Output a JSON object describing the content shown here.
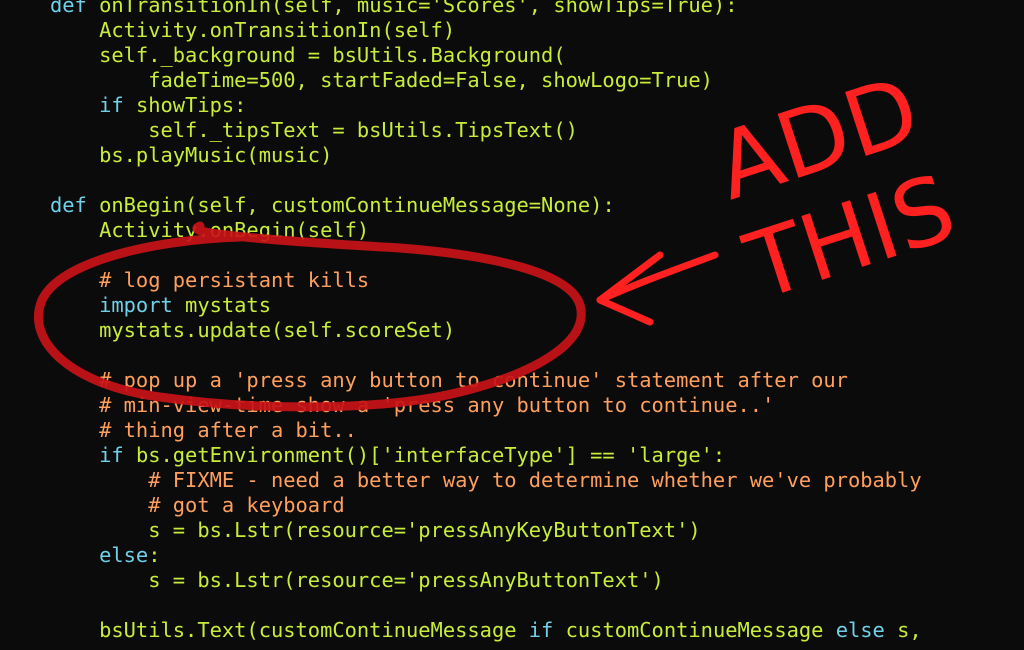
{
  "code_lines": [
    {
      "segments": [
        {
          "t": "def ",
          "c": "def"
        },
        {
          "t": "onTransitionIn",
          "c": "fn"
        },
        {
          "t": "(self, music='Scores', showTips=True):",
          "c": "txt"
        }
      ]
    },
    {
      "segments": [
        {
          "t": "    Activity.onTransitionIn(self)",
          "c": "txt"
        }
      ]
    },
    {
      "segments": [
        {
          "t": "    self._background = bsUtils.Background(",
          "c": "txt"
        }
      ]
    },
    {
      "segments": [
        {
          "t": "        fadeTime=500, startFaded=False, showLogo=True)",
          "c": "txt"
        }
      ]
    },
    {
      "segments": [
        {
          "t": "    if ",
          "c": "kw"
        },
        {
          "t": "showTips:",
          "c": "txt"
        }
      ]
    },
    {
      "segments": [
        {
          "t": "        self._tipsText = bsUtils.TipsText()",
          "c": "txt"
        }
      ]
    },
    {
      "segments": [
        {
          "t": "    bs.playMusic(music)",
          "c": "txt"
        }
      ]
    },
    {
      "segments": [
        {
          "t": "",
          "c": "txt"
        }
      ]
    },
    {
      "segments": [
        {
          "t": "def ",
          "c": "def"
        },
        {
          "t": "onBegin",
          "c": "fn"
        },
        {
          "t": "(self, customContinueMessage=None):",
          "c": "txt"
        }
      ]
    },
    {
      "segments": [
        {
          "t": "    Activity.onBegin(self)",
          "c": "txt"
        }
      ]
    },
    {
      "segments": [
        {
          "t": "",
          "c": "txt"
        }
      ]
    },
    {
      "segments": [
        {
          "t": "    # log persistant kills",
          "c": "cmt"
        }
      ]
    },
    {
      "segments": [
        {
          "t": "    import ",
          "c": "kw"
        },
        {
          "t": "mystats",
          "c": "txt"
        }
      ]
    },
    {
      "segments": [
        {
          "t": "    mystats.update(self.scoreSet)",
          "c": "txt"
        }
      ]
    },
    {
      "segments": [
        {
          "t": "",
          "c": "txt"
        }
      ]
    },
    {
      "segments": [
        {
          "t": "    # pop up a 'press any button to continue' statement after our",
          "c": "cmt"
        }
      ]
    },
    {
      "segments": [
        {
          "t": "    # min-view-time show a 'press any button to continue..'",
          "c": "cmt"
        }
      ]
    },
    {
      "segments": [
        {
          "t": "    # thing after a bit..",
          "c": "cmt"
        }
      ]
    },
    {
      "segments": [
        {
          "t": "    if ",
          "c": "kw"
        },
        {
          "t": "bs.getEnvironment()['interfaceType'] == 'large':",
          "c": "txt"
        }
      ]
    },
    {
      "segments": [
        {
          "t": "        # FIXME - need a better way to determine whether we've probably",
          "c": "cmt"
        }
      ]
    },
    {
      "segments": [
        {
          "t": "        # got a keyboard",
          "c": "cmt"
        }
      ]
    },
    {
      "segments": [
        {
          "t": "        s = bs.Lstr(resource='pressAnyKeyButtonText')",
          "c": "txt"
        }
      ]
    },
    {
      "segments": [
        {
          "t": "    else",
          "c": "kw"
        },
        {
          "t": ":",
          "c": "txt"
        }
      ]
    },
    {
      "segments": [
        {
          "t": "        s = bs.Lstr(resource='pressAnyButtonText')",
          "c": "txt"
        }
      ]
    },
    {
      "segments": [
        {
          "t": "",
          "c": "txt"
        }
      ]
    },
    {
      "segments": [
        {
          "t": "    bsUtils.Text(customContinueMessage ",
          "c": "txt"
        },
        {
          "t": "if ",
          "c": "kw"
        },
        {
          "t": "customContinueMessage ",
          "c": "txt"
        },
        {
          "t": "else ",
          "c": "kw"
        },
        {
          "t": "s,",
          "c": "txt"
        }
      ]
    }
  ],
  "annotation": {
    "line1": "ADD",
    "line2": "THIS",
    "color": "#ff2020"
  },
  "colors": {
    "background": "#0b0b0b",
    "keyword": "#6fd0e8",
    "text": "#c8ec3a",
    "comment": "#ff9f5e",
    "annotation": "#ff2020"
  }
}
